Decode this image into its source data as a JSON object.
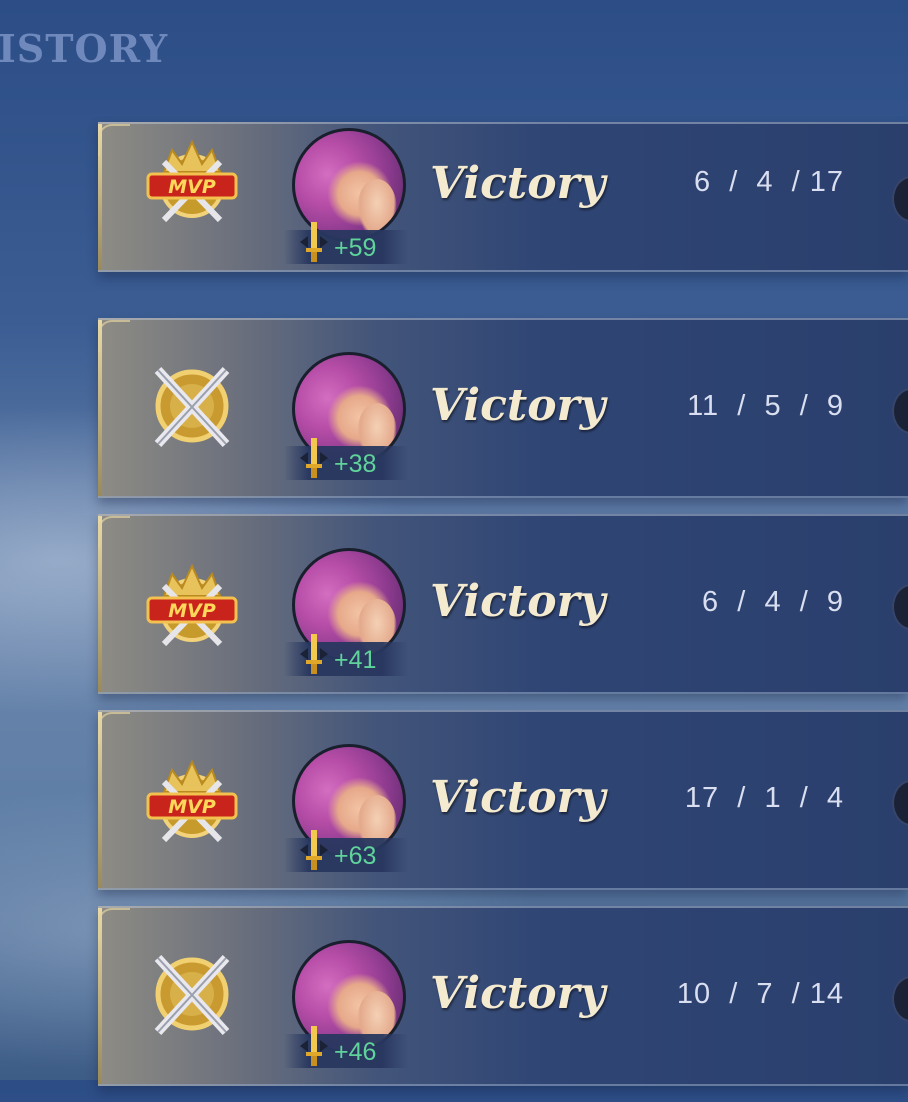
{
  "header": {
    "title": "ISTORY"
  },
  "matches": [
    {
      "result": "Victory",
      "kda": " 6  /  4  / 17",
      "points": "+59",
      "badge": "mvp-badge-icon"
    },
    {
      "result": "Victory",
      "kda": "11  /  5  /  9",
      "points": "+38",
      "badge": "crossed-swords-badge-icon"
    },
    {
      "result": "Victory",
      "kda": " 6  /  4  /  9",
      "points": "+41",
      "badge": "mvp-badge-icon"
    },
    {
      "result": "Victory",
      "kda": "17  /  1  /  4",
      "points": "+63",
      "badge": "mvp-badge-icon"
    },
    {
      "result": "Victory",
      "kda": "10  /  7  / 14",
      "points": "+46",
      "badge": "crossed-swords-badge-icon"
    }
  ],
  "colors": {
    "points": "#5fd39a",
    "result": "#f4ead0",
    "kda": "#d9def0",
    "title": "#6f89bd"
  }
}
